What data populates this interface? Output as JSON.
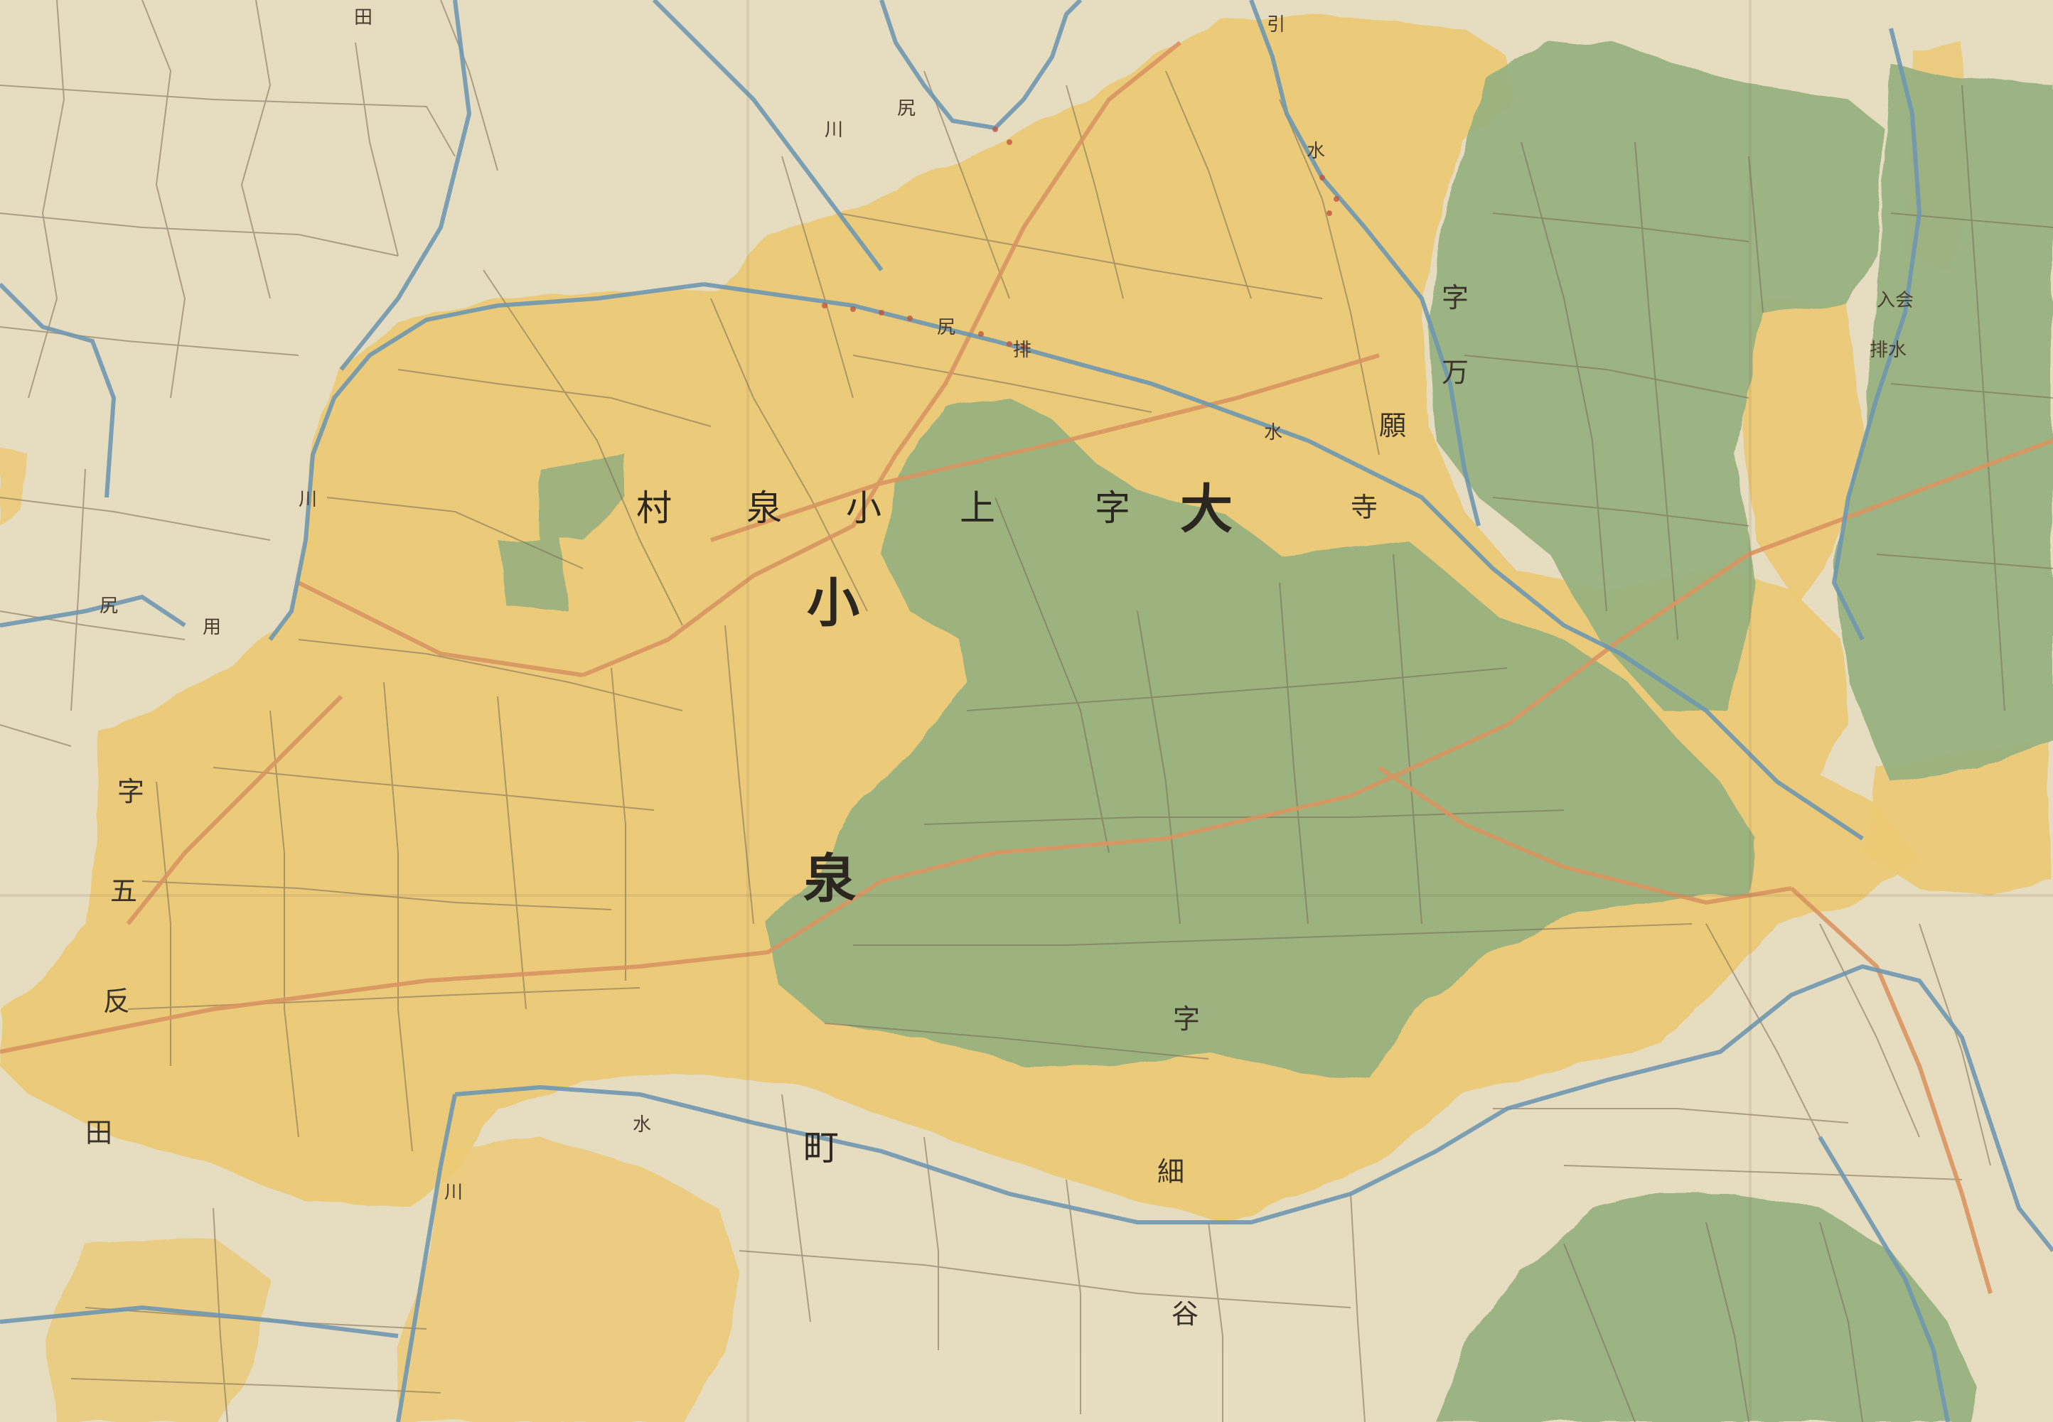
{
  "map": {
    "colors": {
      "paper": "#e6dcc0",
      "paddy_yellow": "#ebc974",
      "dry_field_green": "#98b07f",
      "water_channel": "#6f97b0",
      "footpath": "#d99561",
      "plot_line": "#7a6a55",
      "ink": "#2b2620"
    },
    "title_labels": {
      "c1": "大",
      "c2": "字",
      "c3": "上",
      "c4": "小",
      "c5": "泉",
      "c6": "村"
    },
    "district_labels": {
      "koizumi_1": "小",
      "koizumi_2": "泉",
      "mankanji_1": "字",
      "mankanji_2": "万",
      "mankanji_3": "願",
      "mankanji_4": "寺",
      "gotanda_1": "字",
      "gotanda_2": "五",
      "gotanda_3": "反",
      "gotanda_4": "田",
      "hosoya_1": "字",
      "hosoya_2": "細",
      "hosoya_3": "谷",
      "machi": "町",
      "top_left": "田"
    },
    "small_marks": {
      "sui_1": "水",
      "sui_2": "水",
      "sui_3": "水",
      "hai_1": "排",
      "hai_2": "排水",
      "kawa_1": "川",
      "kawa_2": "川",
      "kawa_3": "川",
      "ni_1": "尻",
      "ni_2": "尻",
      "ni_3": "尻",
      "nyusui": "入会",
      "ri_1": "引",
      "sha_1": "用"
    }
  }
}
